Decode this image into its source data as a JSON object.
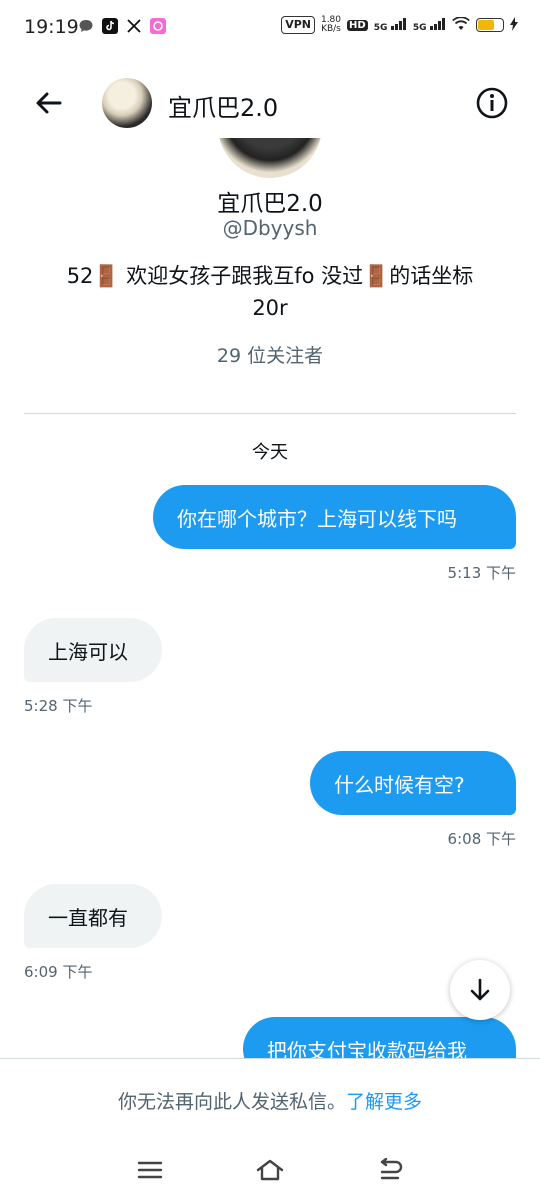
{
  "status_bar": {
    "time": "19:19",
    "vpn": "VPN",
    "net_speed_value": "1.80",
    "net_speed_unit": "KB/s",
    "hd": "HD",
    "sim1": "5G",
    "sim2": "5G",
    "battery_level": 0.7,
    "icons": [
      "message-icon",
      "tiktok-icon",
      "x-icon",
      "app-icon"
    ]
  },
  "header": {
    "title": "宜爪巴2.0"
  },
  "profile": {
    "name": "宜爪巴2.0",
    "handle": "@Dbyysh",
    "bio_line1": "52🚪 欢迎女孩子跟我互fo 没过🚪的话坐标",
    "bio_line2": "20r",
    "followers": "29 位关注者"
  },
  "conversation": {
    "day_label": "今天",
    "messages": [
      {
        "direction": "sent",
        "text": "你在哪个城市？上海可以线下吗",
        "time": "5:13 下午"
      },
      {
        "direction": "received",
        "text": "上海可以",
        "time": "5:28 下午"
      },
      {
        "direction": "sent",
        "text": "什么时候有空?",
        "time": "6:08 下午"
      },
      {
        "direction": "received",
        "text": "一直都有",
        "time": "6:09 下午"
      },
      {
        "direction": "sent",
        "text": "把你支付宝收款码给我",
        "time": ""
      }
    ]
  },
  "footer": {
    "notice": "你无法再向此人发送私信。",
    "link": "了解更多"
  },
  "colors": {
    "accent": "#1d9bf0",
    "received_bubble": "#eff3f4",
    "secondary_text": "#536471"
  }
}
